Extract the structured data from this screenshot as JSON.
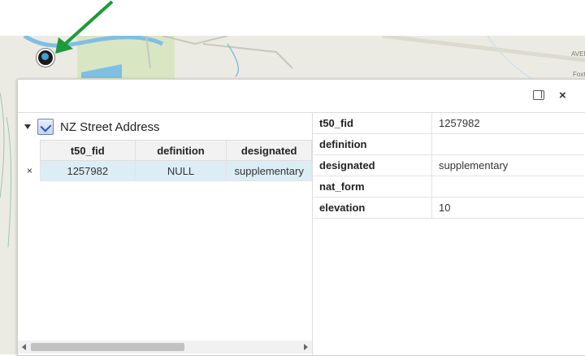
{
  "map": {
    "labels": [
      "AVEN",
      "Foxt"
    ]
  },
  "popup": {
    "layer_title": "NZ Street Address",
    "table": {
      "columns": [
        "t50_fid",
        "definition",
        "designated"
      ],
      "rows": [
        [
          "1257982",
          "NULL",
          "supplementary"
        ]
      ]
    },
    "properties": [
      {
        "key": "t50_fid",
        "value": "1257982"
      },
      {
        "key": "definition",
        "value": ""
      },
      {
        "key": "designated",
        "value": "supplementary"
      },
      {
        "key": "nat_form",
        "value": ""
      },
      {
        "key": "elevation",
        "value": "10"
      }
    ]
  },
  "colors": {
    "arrow": "#1e9a3a",
    "selected_row": "#dcedf6",
    "map_bg": "#ecebe3",
    "water": "#7fbfe3"
  }
}
